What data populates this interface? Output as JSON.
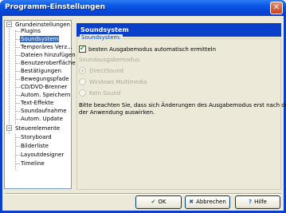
{
  "window": {
    "title": "Programm-Einstellungen",
    "close": "✕"
  },
  "tree": {
    "nodes": [
      {
        "label": "Grundeinstellungen",
        "expander": "−"
      },
      {
        "label": "Plugins"
      },
      {
        "label": "Soundsystem",
        "selected": true
      },
      {
        "label": "Temporäres Verz..."
      },
      {
        "label": "Dateien hinzufügen"
      },
      {
        "label": "Benutzeroberfläche"
      },
      {
        "label": "Bestätigungen"
      },
      {
        "label": "Bewegungspfade"
      },
      {
        "label": "CD/DVD-Brenner"
      },
      {
        "label": "Autom. Speichern"
      },
      {
        "label": "Text-Effekte"
      },
      {
        "label": "Soundaufnahme"
      },
      {
        "label": "Autom. Update"
      },
      {
        "label": "Steuerelemente",
        "expander": "−"
      },
      {
        "label": "Storyboard"
      },
      {
        "label": "Bilderliste"
      },
      {
        "label": "Layoutdesigner"
      },
      {
        "label": "Timeline"
      }
    ]
  },
  "panel": {
    "header": "Soundsystem",
    "group_title": "Soundsystem:",
    "auto_detect": {
      "label": "besten Ausgabemodus automatisch ermitteln",
      "checked": true
    },
    "mode_label": "Soundausgabemodus:",
    "modes": [
      {
        "label": "DirectSound",
        "selected": true
      },
      {
        "label": "Windows Multimedia",
        "selected": false
      },
      {
        "label": "Kein Sound",
        "selected": false
      }
    ],
    "note_line1": "Bitte beachten Sie, dass sich Änderungen des Ausgabemodus erst nach dem Neustart",
    "note_line2": "der Anwendung auswirken."
  },
  "buttons": {
    "ok": {
      "icon": "✔",
      "label": "OK"
    },
    "cancel": {
      "icon": "✖",
      "label": "Abbrechen"
    },
    "help": {
      "icon": "?",
      "label": "Hilfe"
    }
  },
  "colors": {
    "titlebar": "#0a58e6",
    "selection": "#316ac5",
    "header": "#0a3fc9"
  }
}
